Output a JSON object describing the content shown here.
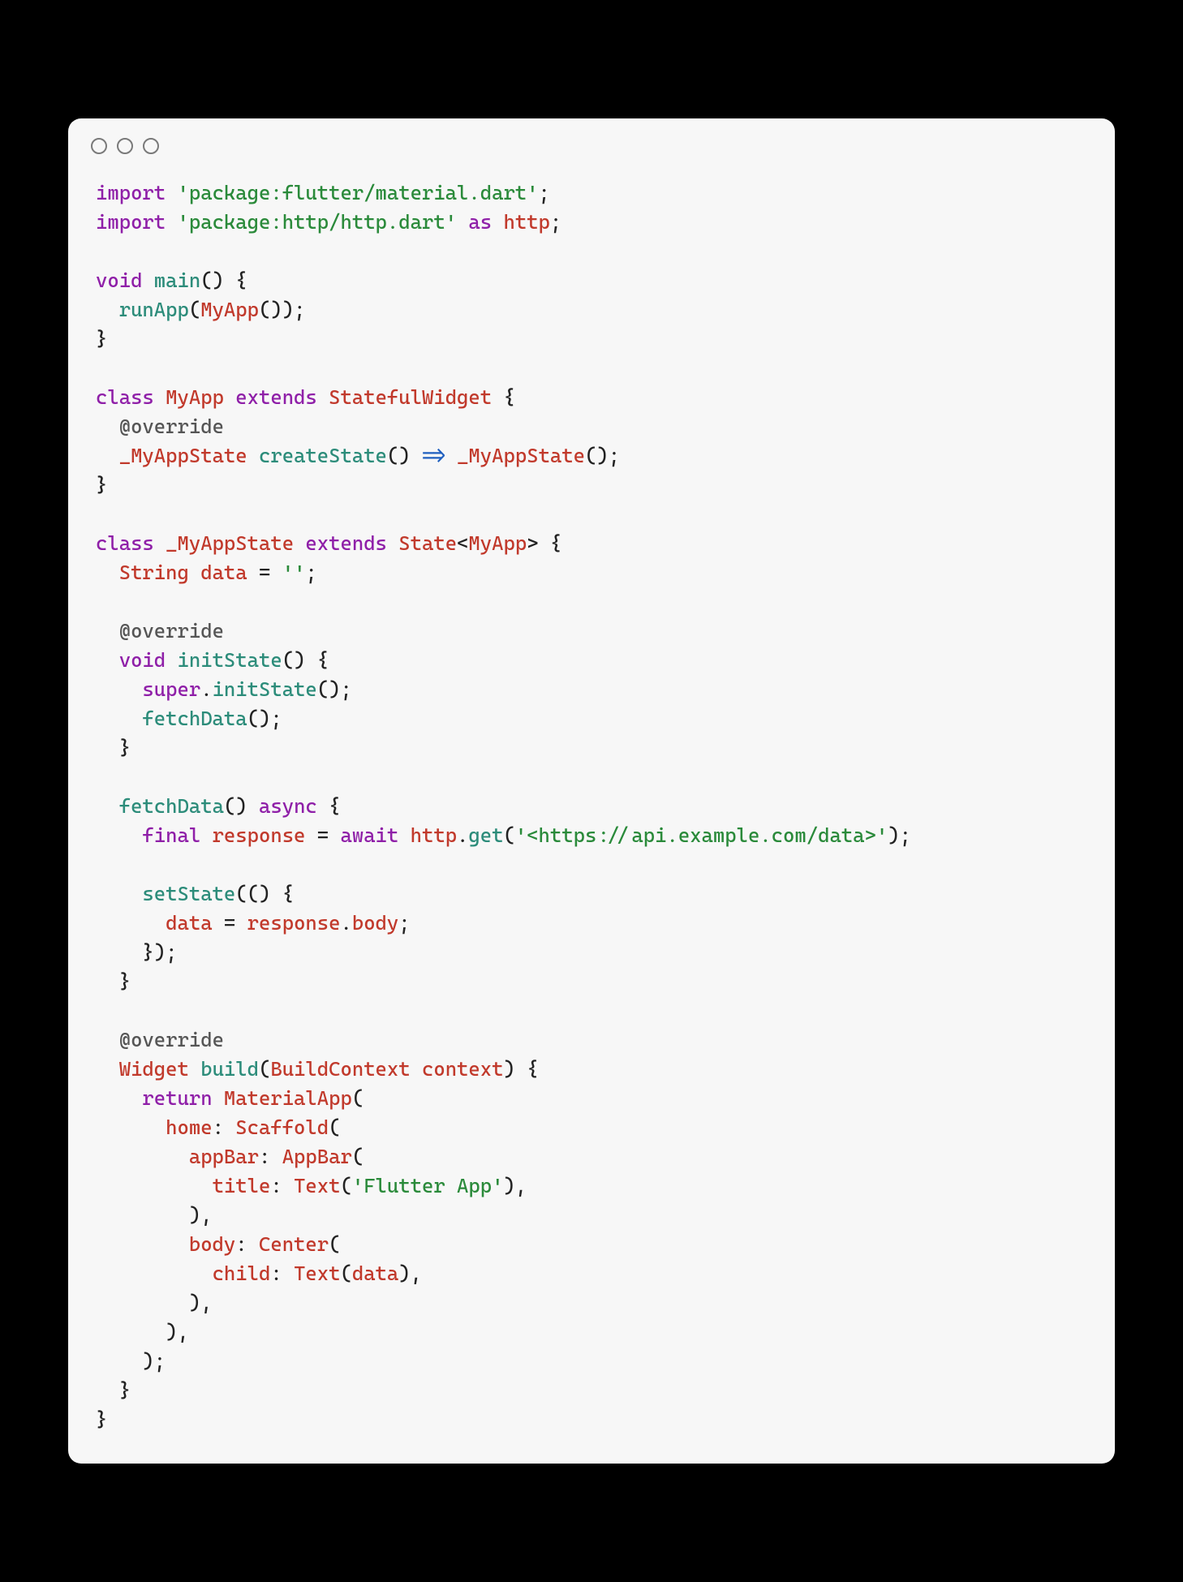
{
  "code": {
    "l1": {
      "kw": "import",
      "str": "'package:flutter/material.dart'",
      "semi": ";"
    },
    "l2": {
      "kw1": "import",
      "str": "'package:http/http.dart'",
      "kw2": "as",
      "ident": "http",
      "semi": ";"
    },
    "l4": {
      "kw": "void",
      "fn": "main",
      "rest": "() {"
    },
    "l5": {
      "fn": "runApp",
      "p1": "(",
      "cls": "MyApp",
      "p2": "());"
    },
    "l6": {
      "brace": "}"
    },
    "l8": {
      "kw1": "class",
      "cls1": "MyApp",
      "kw2": "extends",
      "cls2": "StatefulWidget",
      "brace": " {"
    },
    "l9": {
      "ann": "@override"
    },
    "l10": {
      "cls1": "_MyAppState",
      "fn": "createState",
      "p1": "() ",
      "op": "=>",
      "p2": " ",
      "cls2": "_MyAppState",
      "p3": "();"
    },
    "l11": {
      "brace": "}"
    },
    "l13": {
      "kw1": "class",
      "cls1": "_MyAppState",
      "kw2": "extends",
      "cls2": "State",
      "lt": "<",
      "cls3": "MyApp",
      "gt": ">",
      "brace": " {"
    },
    "l14": {
      "type": "String",
      "var": "data",
      "eq": " = ",
      "str": "''",
      "semi": ";"
    },
    "l16": {
      "ann": "@override"
    },
    "l17": {
      "kw": "void",
      "fn": "initState",
      "rest": "() {"
    },
    "l18": {
      "obj": "super",
      "dot": ".",
      "fn": "initState",
      "rest": "();"
    },
    "l19": {
      "fn": "fetchData",
      "rest": "();"
    },
    "l20": {
      "brace": "}"
    },
    "l22": {
      "fn": "fetchData",
      "p": "() ",
      "kw": "async",
      "brace": " {"
    },
    "l23": {
      "kw1": "final",
      "var": "response",
      "eq": " = ",
      "kw2": "await",
      "sp": " ",
      "obj": "http",
      "dot": ".",
      "fn": "get",
      "p1": "(",
      "str": "'<https://api.example.com/data>'",
      "p2": ");"
    },
    "l25": {
      "fn": "setState",
      "rest": "(() {"
    },
    "l26": {
      "var": "data",
      "eq": " = ",
      "obj": "response",
      "dot": ".",
      "prop": "body",
      "semi": ";"
    },
    "l27": {
      "rest": "});"
    },
    "l28": {
      "brace": "}"
    },
    "l30": {
      "ann": "@override"
    },
    "l31": {
      "type": "Widget",
      "fn": "build",
      "p1": "(",
      "ptype": "BuildContext",
      "pname": "context",
      "p2": ") {"
    },
    "l32": {
      "kw": "return",
      "cls": "MaterialApp",
      "p": "("
    },
    "l33": {
      "label": "home",
      "colon": ": ",
      "cls": "Scaffold",
      "p": "("
    },
    "l34": {
      "label": "appBar",
      "colon": ": ",
      "cls": "AppBar",
      "p": "("
    },
    "l35": {
      "label": "title",
      "colon": ": ",
      "cls": "Text",
      "p1": "(",
      "str": "'Flutter App'",
      "p2": "),"
    },
    "l36": {
      "rest": "),"
    },
    "l37": {
      "label": "body",
      "colon": ": ",
      "cls": "Center",
      "p": "("
    },
    "l38": {
      "label": "child",
      "colon": ": ",
      "cls": "Text",
      "p1": "(",
      "var": "data",
      "p2": "),"
    },
    "l39": {
      "rest": "),"
    },
    "l40": {
      "rest": "),"
    },
    "l41": {
      "rest": ");"
    },
    "l42": {
      "brace": "}"
    },
    "l43": {
      "brace": "}"
    }
  }
}
